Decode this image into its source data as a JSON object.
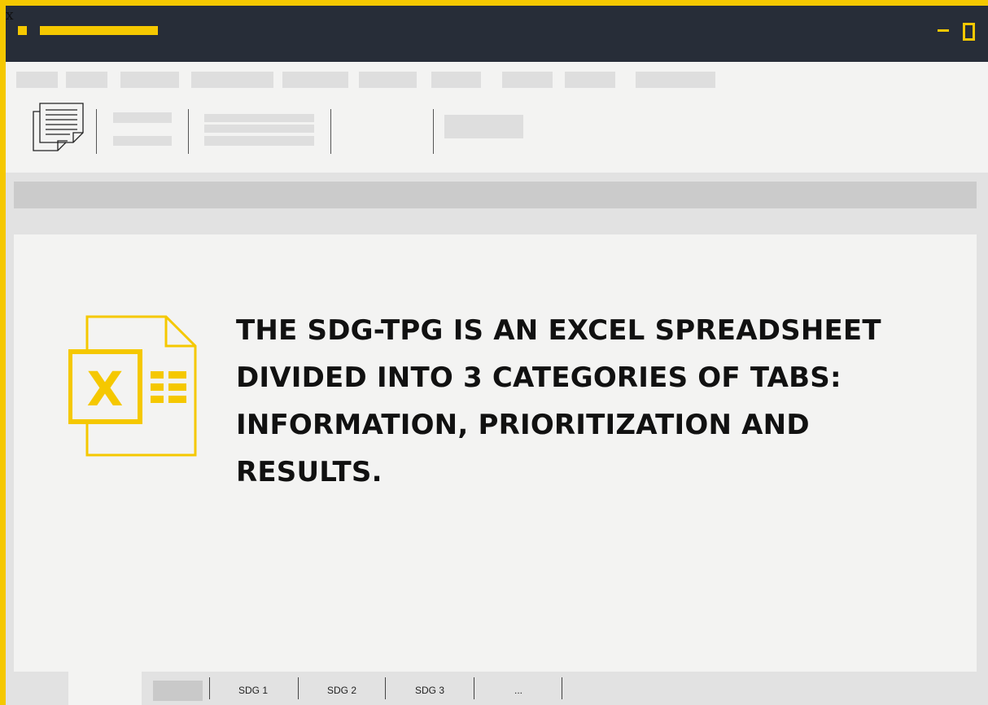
{
  "window": {
    "close_glyph": "x"
  },
  "content": {
    "headline": "THE SDG-TPG IS AN EXCEL SPREADSHEET DIVIDED INTO 3 CATEGORIES OF TABS: INFORMATION, PRIORITIZATION AND RESULTS."
  },
  "sheet_tabs": [
    {
      "label": "SDG 1"
    },
    {
      "label": "SDG 2"
    },
    {
      "label": "SDG 3"
    },
    {
      "label": "..."
    }
  ],
  "colors": {
    "accent": "#f5c800",
    "titlebar": "#272d38",
    "background": "#f3f3f2",
    "placeholder": "#dedede"
  },
  "icons": [
    "paste-icon",
    "excel-icon",
    "minimize-icon",
    "maximize-icon",
    "close-icon"
  ]
}
